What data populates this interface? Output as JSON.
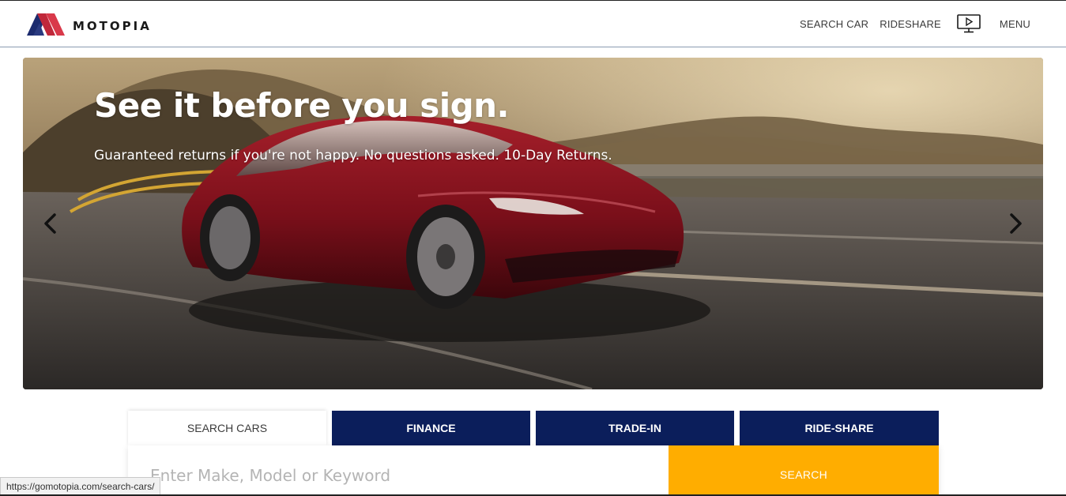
{
  "brand": {
    "name": "MOTOPIA",
    "colors": {
      "logo_left": "#1c2b6e",
      "logo_right": "#c0283a"
    }
  },
  "nav": {
    "links": [
      {
        "label": "SEARCH CAR"
      },
      {
        "label": "RIDESHARE"
      }
    ],
    "video_icon": "tv-play-icon",
    "menu_label": "MENU"
  },
  "hero": {
    "title": "See it before you sign.",
    "subtitle": "Guaranteed returns if you're not happy. No questions asked. 10-Day Returns.",
    "prev_icon": "chevron-left-icon",
    "next_icon": "chevron-right-icon"
  },
  "tabs": [
    {
      "label": "SEARCH CARS",
      "active": true
    },
    {
      "label": "FINANCE",
      "active": false
    },
    {
      "label": "TRADE-IN",
      "active": false
    },
    {
      "label": "RIDE-SHARE",
      "active": false
    }
  ],
  "search": {
    "placeholder": "Enter Make, Model or Keyword",
    "value": "",
    "button_label": "SEARCH"
  },
  "status_bar": {
    "url": "https://gomotopia.com/search-cars/"
  },
  "theme": {
    "navy": "#0b1e5b",
    "accent": "#ffad00"
  }
}
